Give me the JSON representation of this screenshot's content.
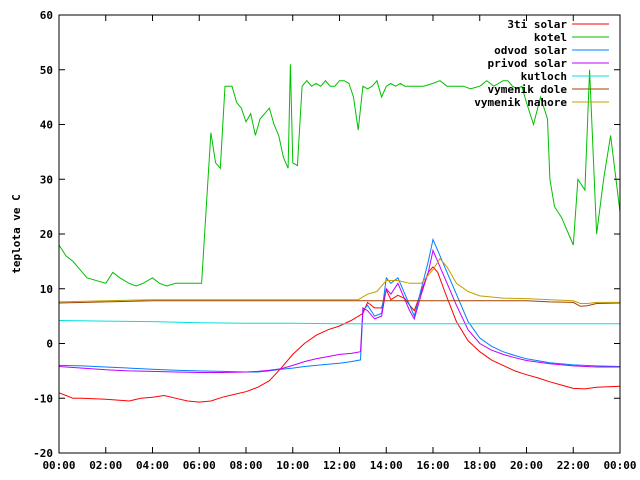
{
  "chart_data": {
    "type": "line",
    "title": "",
    "ylabel": "teplota ve C",
    "xlabel": "",
    "xlim": [
      0,
      24
    ],
    "ylim": [
      -20,
      60
    ],
    "grid": false,
    "legend_position": "top-right",
    "x_ticks": [
      "00:00",
      "02:00",
      "04:00",
      "06:00",
      "08:00",
      "10:00",
      "12:00",
      "14:00",
      "16:00",
      "18:00",
      "20:00",
      "22:00",
      "00:00"
    ],
    "y_ticks": [
      -20,
      -10,
      0,
      10,
      20,
      30,
      40,
      50,
      60
    ],
    "series": [
      {
        "name": "3ti solar",
        "color": "#ff0000",
        "x": [
          0,
          0.3,
          0.6,
          1,
          2,
          3,
          3.5,
          4,
          4.5,
          5,
          5.5,
          6,
          6.5,
          7,
          7.5,
          8,
          8.5,
          9,
          9.5,
          10,
          10.5,
          11,
          11.5,
          12,
          12.5,
          13,
          13.2,
          13.5,
          13.8,
          14,
          14.2,
          14.5,
          14.8,
          15,
          15.2,
          15.5,
          15.8,
          16,
          16.2,
          16.5,
          17,
          17.5,
          18,
          18.5,
          19,
          19.5,
          20,
          20.5,
          21,
          21.5,
          22,
          22.5,
          23,
          23.5,
          24
        ],
        "y": [
          -9,
          -9.5,
          -10,
          -10,
          -10.2,
          -10.5,
          -10,
          -9.8,
          -9.5,
          -10,
          -10.5,
          -10.7,
          -10.5,
          -9.8,
          -9.3,
          -8.8,
          -8,
          -6.8,
          -4.5,
          -2,
          0,
          1.5,
          2.5,
          3.2,
          4.2,
          5.5,
          7.5,
          6.5,
          6.5,
          9.8,
          8,
          8.8,
          8.2,
          7,
          6,
          9.5,
          13,
          14,
          13,
          9.5,
          4,
          0.5,
          -1.5,
          -3,
          -4,
          -5,
          -5.7,
          -6.3,
          -7,
          -7.6,
          -8.2,
          -8.3,
          -8,
          -7.9,
          -7.8
        ]
      },
      {
        "name": "kotel",
        "color": "#00c000",
        "x": [
          0,
          0.3,
          0.6,
          0.8,
          1.2,
          2,
          2.3,
          2.6,
          3,
          3.3,
          3.6,
          4,
          4.3,
          4.6,
          5,
          5.5,
          6,
          6.1,
          6.3,
          6.5,
          6.7,
          6.9,
          7.1,
          7.2,
          7.4,
          7.6,
          7.8,
          8,
          8.2,
          8.4,
          8.6,
          8.8,
          9,
          9.2,
          9.4,
          9.6,
          9.7,
          9.8,
          9.9,
          10,
          10.2,
          10.4,
          10.6,
          10.8,
          11,
          11.2,
          11.4,
          11.6,
          11.8,
          12,
          12.2,
          12.4,
          12.6,
          12.8,
          13,
          13.2,
          13.4,
          13.6,
          13.8,
          14,
          14.2,
          14.4,
          14.6,
          14.8,
          15,
          15.3,
          15.6,
          16,
          16.3,
          16.6,
          17,
          17.3,
          17.6,
          18,
          18.3,
          18.6,
          19,
          19.2,
          19.4,
          19.6,
          19.8,
          20,
          20.3,
          20.6,
          20.9,
          21,
          21.2,
          21.5,
          21.8,
          22,
          22.2,
          22.5,
          22.7,
          23,
          23.3,
          23.6,
          24
        ],
        "y": [
          18,
          16,
          15,
          14,
          12,
          11,
          13,
          12,
          11,
          10.5,
          11,
          12,
          11,
          10.5,
          11,
          11,
          11,
          11,
          25,
          38.5,
          33,
          32,
          47,
          47,
          47,
          44,
          43,
          40.5,
          42,
          38,
          41,
          42,
          43,
          40,
          38,
          34,
          33,
          32,
          51,
          33,
          32.5,
          47,
          48,
          47,
          47.5,
          47,
          48,
          47,
          47,
          48,
          48,
          47.5,
          45,
          39,
          47,
          46.5,
          47,
          48,
          45,
          47,
          47.5,
          47,
          47.5,
          47,
          47,
          47,
          47,
          47.5,
          48,
          47,
          47,
          47,
          46.5,
          47,
          48,
          47,
          48,
          48,
          47,
          46.5,
          47,
          44,
          40,
          45,
          41,
          30,
          25,
          23,
          20,
          18,
          30,
          28,
          50,
          20,
          30,
          38,
          24
        ]
      },
      {
        "name": "odvod solar",
        "color": "#0080ff",
        "x": [
          0,
          1,
          2,
          3,
          4,
          5,
          6,
          7,
          8,
          8.5,
          9,
          9.5,
          10,
          10.5,
          11,
          11.5,
          12,
          12.5,
          12.9,
          13,
          13.2,
          13.5,
          13.8,
          14,
          14.2,
          14.5,
          14.8,
          15,
          15.2,
          15.5,
          15.8,
          16,
          16.2,
          16.5,
          17,
          17.5,
          18,
          18.5,
          19,
          19.5,
          20,
          21,
          22,
          23,
          24
        ],
        "y": [
          -4,
          -4.1,
          -4.3,
          -4.5,
          -4.7,
          -4.9,
          -5,
          -5.1,
          -5.2,
          -5.2,
          -5,
          -4.7,
          -4.5,
          -4.2,
          -4,
          -3.8,
          -3.6,
          -3.3,
          -3,
          6,
          7,
          5,
          5.5,
          12,
          11,
          12,
          9,
          7,
          5,
          10,
          15,
          19,
          17,
          14,
          9,
          4,
          1,
          -0.5,
          -1.5,
          -2.2,
          -2.8,
          -3.5,
          -3.9,
          -4.1,
          -4.2
        ]
      },
      {
        "name": "privod solar",
        "color": "#c000ff",
        "x": [
          0,
          1,
          2,
          3,
          4,
          5,
          6,
          7,
          8,
          8.5,
          9,
          9.5,
          10,
          10.5,
          11,
          11.5,
          12,
          12.5,
          12.9,
          13,
          13.2,
          13.5,
          13.8,
          14,
          14.2,
          14.5,
          14.8,
          15,
          15.2,
          15.5,
          15.8,
          16,
          16.2,
          16.5,
          17,
          17.5,
          18,
          18.5,
          19,
          19.5,
          20,
          21,
          22,
          23,
          24
        ],
        "y": [
          -4.2,
          -4.5,
          -4.8,
          -5,
          -5.1,
          -5.2,
          -5.3,
          -5.3,
          -5.2,
          -5.1,
          -4.9,
          -4.6,
          -4,
          -3.3,
          -2.8,
          -2.4,
          -2,
          -1.8,
          -1.5,
          6.5,
          6,
          4.5,
          5,
          10,
          9,
          11,
          8,
          6,
          4.5,
          9,
          13,
          17,
          15,
          12,
          7,
          2.5,
          0,
          -1.2,
          -2,
          -2.6,
          -3.1,
          -3.7,
          -4.1,
          -4.3,
          -4.3
        ]
      },
      {
        "name": "kutloch",
        "color": "#00e0e0",
        "x": [
          0,
          2,
          4,
          6,
          8,
          10,
          12,
          14,
          16,
          18,
          20,
          22,
          24
        ],
        "y": [
          4.2,
          4.1,
          4,
          3.8,
          3.7,
          3.7,
          3.6,
          3.6,
          3.6,
          3.6,
          3.6,
          3.6,
          3.6
        ]
      },
      {
        "name": "vymenik dole",
        "color": "#a04000",
        "x": [
          0,
          2,
          4,
          6,
          8,
          10,
          12,
          13,
          14,
          15,
          16,
          17,
          18,
          19,
          20,
          21,
          22,
          22.3,
          22.6,
          23,
          24
        ],
        "y": [
          7.4,
          7.6,
          7.8,
          7.8,
          7.8,
          7.8,
          7.8,
          7.8,
          7.8,
          7.8,
          7.8,
          7.8,
          7.8,
          7.8,
          7.8,
          7.6,
          7.5,
          6.8,
          6.9,
          7.3,
          7.4
        ]
      },
      {
        "name": "vymenik nahore",
        "color": "#c0a000",
        "x": [
          0,
          2,
          4,
          6,
          8,
          10,
          12,
          12.8,
          13.2,
          13.6,
          14,
          14.5,
          15,
          15.5,
          16,
          16.3,
          16.6,
          17,
          17.5,
          18,
          19,
          20,
          21,
          22,
          22.3,
          22.6,
          23,
          24
        ],
        "y": [
          7.6,
          7.8,
          8,
          8,
          8,
          8,
          8,
          8,
          9,
          9.5,
          11.5,
          11.5,
          11,
          11,
          13.5,
          15.5,
          14,
          11,
          9.5,
          8.7,
          8.3,
          8.2,
          8,
          7.8,
          7.3,
          7.3,
          7.5,
          7.5
        ]
      }
    ]
  }
}
